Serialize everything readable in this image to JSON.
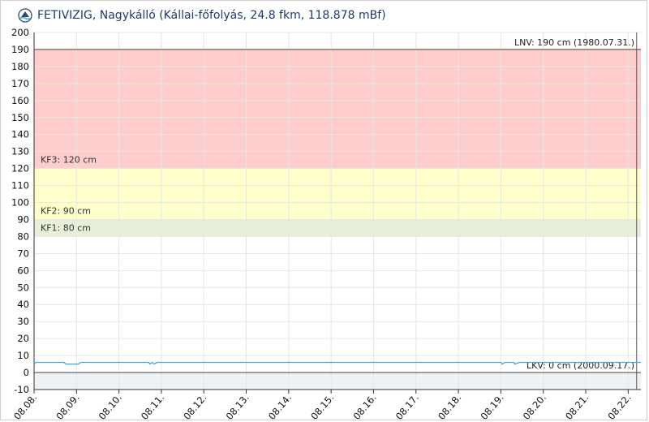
{
  "header": {
    "title": "FETIVIZIG, Nagykálló (Kállai-főfolyás, 24.8 fkm, 118.878 mBf)"
  },
  "colors": {
    "kf3": "#ffcccc",
    "kf2": "#ffffcc",
    "kf1": "#e6f0d8",
    "below_zero": "#eef1f6",
    "series": "#3fa7d6",
    "grid": "#e6e6e6",
    "ref_line": "#555555"
  },
  "chart_data": {
    "type": "line",
    "ylim": [
      -10,
      200
    ],
    "yticks": [
      200,
      190,
      180,
      170,
      160,
      150,
      140,
      130,
      120,
      110,
      100,
      90,
      80,
      70,
      60,
      50,
      40,
      30,
      20,
      10,
      0,
      -10
    ],
    "xlim": [
      0,
      14.3
    ],
    "xticks": [
      {
        "x": 0,
        "label": "08.08."
      },
      {
        "x": 1,
        "label": "08.09."
      },
      {
        "x": 2,
        "label": "08.10."
      },
      {
        "x": 3,
        "label": "08.11."
      },
      {
        "x": 4,
        "label": "08.12."
      },
      {
        "x": 5,
        "label": "08.13."
      },
      {
        "x": 6,
        "label": "08.14."
      },
      {
        "x": 7,
        "label": "08.15."
      },
      {
        "x": 8,
        "label": "08.16."
      },
      {
        "x": 9,
        "label": "08.17."
      },
      {
        "x": 10,
        "label": "08.18."
      },
      {
        "x": 11,
        "label": "08.19."
      },
      {
        "x": 12,
        "label": "08.20."
      },
      {
        "x": 13,
        "label": "08.21."
      },
      {
        "x": 14,
        "label": "08.22."
      }
    ],
    "bands": [
      {
        "name": "KF3",
        "label": "KF3: 120 cm",
        "from": 120,
        "to": 190,
        "color": "#ffcccc"
      },
      {
        "name": "KF2",
        "label": "KF2: 90 cm",
        "from": 90,
        "to": 120,
        "color": "#ffffcc"
      },
      {
        "name": "KF1",
        "label": "KF1: 80 cm",
        "from": 80,
        "to": 90,
        "color": "#e6f0d8"
      }
    ],
    "reference_lines": [
      {
        "value": 190,
        "label": "LNV: 190 cm (1980.07.31.)"
      },
      {
        "value": 0,
        "label": "LKV: 0 cm (2000.09.17.)"
      }
    ],
    "current_time_x": 14.2,
    "series": [
      {
        "points": [
          [
            0.0,
            5
          ],
          [
            0.05,
            6
          ],
          [
            0.7,
            6
          ],
          [
            0.75,
            5
          ],
          [
            1.05,
            5
          ],
          [
            1.1,
            6
          ],
          [
            2.7,
            6
          ],
          [
            2.73,
            5
          ],
          [
            2.78,
            6
          ],
          [
            2.83,
            5
          ],
          [
            2.9,
            6
          ],
          [
            11.0,
            6
          ],
          [
            11.03,
            5
          ],
          [
            11.1,
            6
          ],
          [
            11.3,
            6
          ],
          [
            11.33,
            5
          ],
          [
            11.45,
            6
          ],
          [
            14.3,
            6
          ]
        ]
      }
    ]
  }
}
